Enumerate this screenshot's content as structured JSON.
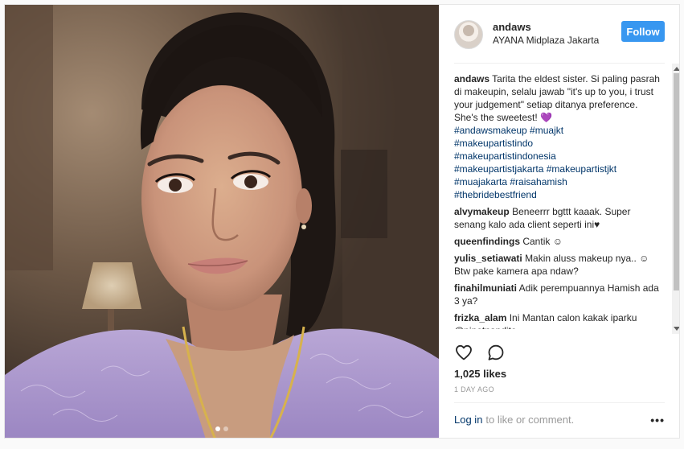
{
  "post": {
    "username": "andaws",
    "location": "AYANA Midplaza Jakarta",
    "follow_label": "Follow"
  },
  "caption": {
    "username": "andaws",
    "text": "Tarita the eldest sister. Si paling pasrah di makeupin, selalu jawab \"it's up to you, i trust your judgement\" setiap ditanya preference. She's the sweetest! 💜",
    "hashtags": [
      "#andawsmakeup #muajkt",
      "#makeupartistindo",
      "#makeupartistindonesia",
      "#makeupartistjakarta #makeupartistjkt",
      "#muajakarta #raisahamish",
      "#thebridebestfriend"
    ]
  },
  "comments": [
    {
      "user": "alvymakeup",
      "text": "Beneerrr bgttt kaaak. Super senang kalo ada client seperti ini♥"
    },
    {
      "user": "queenfindings",
      "text": "Cantik ☺"
    },
    {
      "user": "yulis_setiawati",
      "text": "Makin aluss makeup nya.. ☺ Btw pake kamera apa ndaw?"
    },
    {
      "user": "finahilmuniati",
      "text": "Adik perempuannya Hamish ada 3 ya?"
    },
    {
      "user": "frizka_alam",
      "text": "Ini Mantan calon kakak iparku @pinotnandito"
    }
  ],
  "stats": {
    "likes": "1,025 likes",
    "time": "1 DAY AGO"
  },
  "footer": {
    "login_link": "Log in",
    "login_rest": "to like or comment.",
    "more": "•••"
  },
  "icons": {
    "like": "heart-outline-icon",
    "comment": "speech-bubble-icon",
    "more": "more-options-icon"
  },
  "colors": {
    "follow": "#3897f0",
    "hashtag": "#003569",
    "muted": "#999999"
  }
}
